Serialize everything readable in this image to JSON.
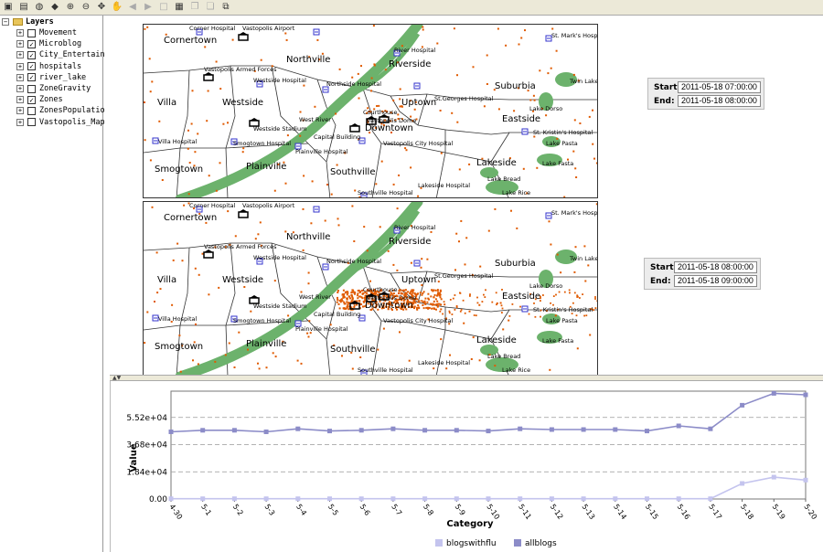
{
  "toolbar": {
    "icons": [
      "open-icon",
      "save-icon",
      "globe-icon",
      "layers-icon",
      "zoom-in-icon",
      "zoom-out-icon",
      "full-extent-icon",
      "pan-icon",
      "back-icon",
      "forward-icon",
      "select-icon",
      "identify-icon",
      "copy-icon",
      "paste-icon",
      "export-icon"
    ]
  },
  "layers": {
    "root_label": "Layers",
    "items": [
      {
        "label": "Movement",
        "checked": false
      },
      {
        "label": "Microblog",
        "checked": true
      },
      {
        "label": "City_Entertain",
        "checked": true
      },
      {
        "label": "hospitals",
        "checked": true
      },
      {
        "label": "river_lake",
        "checked": true
      },
      {
        "label": "ZoneGravity",
        "checked": false
      },
      {
        "label": "Zones",
        "checked": true
      },
      {
        "label": "ZonesPopulation",
        "checked": false
      },
      {
        "label": "Vastopolis_Map",
        "checked": false
      }
    ]
  },
  "map_labels": {
    "zones": [
      "Cornertown",
      "Northville",
      "Riverside",
      "Suburbia",
      "Villa",
      "Westside",
      "Uptown",
      "Eastside",
      "Downtown",
      "Smogtown",
      "Plainville",
      "Southville",
      "Lakeside"
    ],
    "places": [
      "Corner Hospital",
      "Vastopolis Airport",
      "St. Mark's Hospital",
      "River Hospital",
      "Twin Lakes",
      "Vastopolis Armed Forces",
      "Westside Hospital",
      "Northside Hospital",
      "St.Georges Hospital",
      "Lake Dorso",
      "Courthouse",
      "Vastopolis Dome",
      "West River",
      "Westside Stadium",
      "Capital Building",
      "St. Kristin's Hospital",
      "Lake Pasta",
      "Villa Hospital",
      "Smogtown Hospital",
      "Plainville Hospital",
      "Vastopolis City Hospital",
      "Lake Fasta",
      "Lake Bread",
      "Lakeside Hospital",
      "Southville Hospital",
      "Lake Rice"
    ]
  },
  "time_windows": [
    {
      "start_label": "Start:",
      "end_label": "End:",
      "start": "2011-05-18 07:00:00",
      "end": "2011-05-18 08:00:00"
    },
    {
      "start_label": "Start:",
      "end_label": "End:",
      "start": "2011-05-18 08:00:00",
      "end": "2011-05-18 09:00:00"
    }
  ],
  "chart_data": {
    "type": "line",
    "xlabel": "Category",
    "ylabel": "Value",
    "categories": [
      "4-30",
      "5-1",
      "5-2",
      "5-3",
      "5-4",
      "5-5",
      "5-6",
      "5-7",
      "5-8",
      "5-9",
      "5-10",
      "5-11",
      "5-12",
      "5-13",
      "5-14",
      "5-15",
      "5-16",
      "5-17",
      "5-18",
      "5-19",
      "5-20"
    ],
    "yticks": [
      "0.00",
      "1.84e+04",
      "3.68e+04",
      "5.52e+04"
    ],
    "ylim": [
      0,
      73000
    ],
    "grid": true,
    "legend_position": "bottom",
    "series": [
      {
        "name": "blogswithflu",
        "color": "#c4c4ee",
        "values": [
          200,
          200,
          200,
          200,
          200,
          200,
          200,
          200,
          200,
          200,
          200,
          200,
          200,
          200,
          200,
          200,
          200,
          200,
          10500,
          14800,
          12800
        ]
      },
      {
        "name": "allblogs",
        "color": "#8c8cc8",
        "values": [
          45500,
          46500,
          46500,
          45500,
          47500,
          46000,
          46500,
          47500,
          46500,
          46500,
          46000,
          47500,
          47000,
          47000,
          47000,
          46000,
          49500,
          47500,
          63500,
          71500,
          70500
        ]
      }
    ]
  },
  "colors": {
    "river": "#6cb26c",
    "points": "#e05a00",
    "panel_bg": "#ece9d8"
  }
}
